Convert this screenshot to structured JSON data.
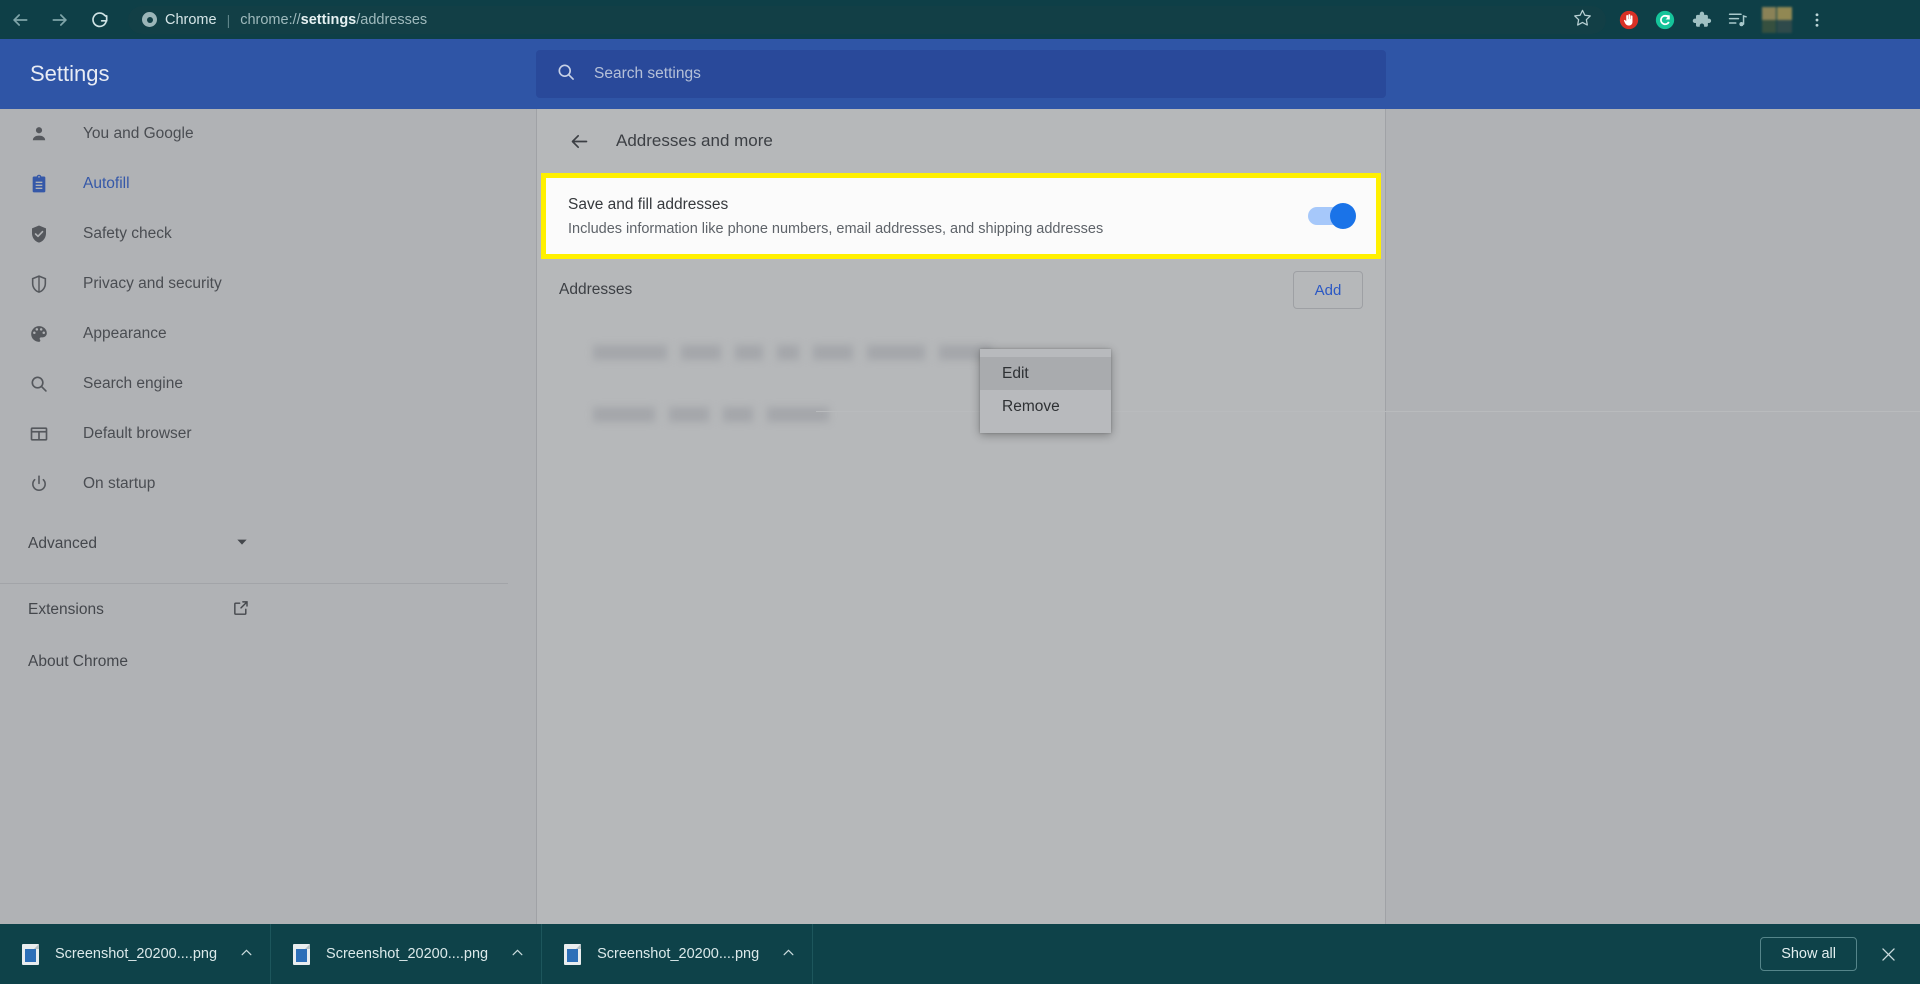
{
  "browser": {
    "back_icon": "back-arrow-icon",
    "forward_icon": "forward-arrow-icon",
    "reload_icon": "reload-icon",
    "app_name": "Chrome",
    "separator": "|",
    "url_prefix": "chrome://",
    "url_bold": "settings",
    "url_suffix": "/addresses",
    "url_full": "chrome://settings/addresses",
    "toolbar_icons": [
      {
        "name": "bookmark-star-icon",
        "title": "Bookmark this tab"
      },
      {
        "name": "blocker-extension-icon",
        "title": "Blocker extension"
      },
      {
        "name": "grammarly-extension-icon",
        "title": "Grammarly"
      },
      {
        "name": "extensions-puzzle-icon",
        "title": "Extensions"
      },
      {
        "name": "media-playlist-icon",
        "title": "Media"
      },
      {
        "name": "profile-avatar-icon",
        "title": "Profile"
      },
      {
        "name": "chrome-menu-icon",
        "title": "Customize and control Google Chrome"
      }
    ]
  },
  "settings": {
    "title": "Settings",
    "search": {
      "placeholder": "Search settings",
      "value": "",
      "icon": "search-icon"
    },
    "sidebar": {
      "items": [
        {
          "label": "You and Google",
          "icon": "person-icon",
          "active": false
        },
        {
          "label": "Autofill",
          "icon": "clipboard-icon",
          "active": true
        },
        {
          "label": "Safety check",
          "icon": "shield-check-icon",
          "active": false
        },
        {
          "label": "Privacy and security",
          "icon": "shield-icon",
          "active": false
        },
        {
          "label": "Appearance",
          "icon": "palette-icon",
          "active": false
        },
        {
          "label": "Search engine",
          "icon": "search-icon",
          "active": false
        },
        {
          "label": "Default browser",
          "icon": "browser-window-icon",
          "active": false
        },
        {
          "label": "On startup",
          "icon": "power-icon",
          "active": false
        }
      ],
      "advanced": {
        "label": "Advanced",
        "icon": "chevron-down-icon"
      },
      "links": [
        {
          "label": "Extensions",
          "icon": "external-link-icon"
        },
        {
          "label": "About Chrome",
          "icon": null
        }
      ]
    },
    "page": {
      "back_icon": "back-arrow-icon",
      "title": "Addresses and more",
      "save_fill": {
        "title": "Save and fill addresses",
        "subtitle": "Includes information like phone numbers, email addresses, and shipping addresses",
        "toggle_on": true,
        "highlight_color": "#fff000"
      },
      "addresses": {
        "section_label": "Addresses",
        "add_button": "Add",
        "add_button_color": "#2b58c4",
        "rows": [
          {
            "redacted": true,
            "blocks": [
              74,
              40,
              28,
              22,
              40,
              58,
              52
            ]
          },
          {
            "redacted": true,
            "blocks": [
              62,
              40,
              30,
              62
            ]
          }
        ]
      },
      "context_menu": {
        "items": [
          {
            "label": "Edit",
            "hovered": true
          },
          {
            "label": "Remove",
            "hovered": false
          }
        ]
      }
    }
  },
  "downloads": {
    "items": [
      {
        "filename": "Screenshot_20200....png",
        "icon": "file-image-icon",
        "caret": "chevron-up-icon"
      },
      {
        "filename": "Screenshot_20200....png",
        "icon": "file-image-icon",
        "caret": "chevron-up-icon"
      },
      {
        "filename": "Screenshot_20200....png",
        "icon": "file-image-icon",
        "caret": "chevron-up-icon"
      }
    ],
    "show_all_label": "Show all",
    "close_icon": "close-icon"
  }
}
